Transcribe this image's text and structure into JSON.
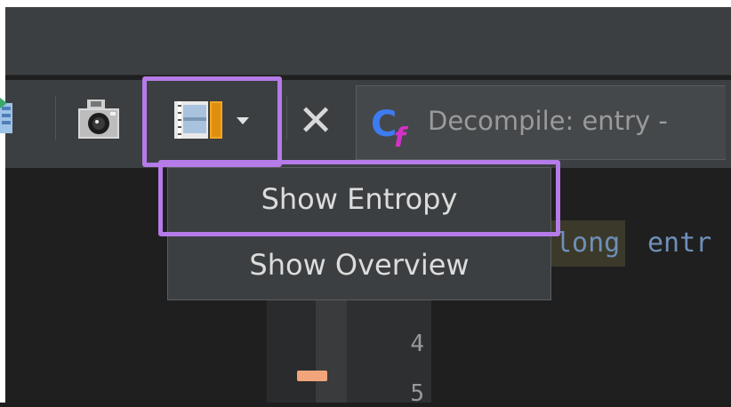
{
  "toolbar": {
    "icons": [
      "file-icon",
      "camera-icon",
      "film-strip-icon",
      "dropdown-arrow-icon",
      "close-icon"
    ],
    "close_label": "✕"
  },
  "decompile_tab": {
    "label": "Decompile: entry -",
    "icon": "cf-icon"
  },
  "menu": {
    "items": [
      {
        "label": "Show Entropy",
        "highlighted": true
      },
      {
        "label": "Show Overview",
        "highlighted": false
      }
    ]
  },
  "editor": {
    "code_keyword": "long",
    "code_rest": " entr"
  },
  "gutter": {
    "line_numbers": [
      "4",
      "5"
    ]
  },
  "colors": {
    "highlight": "#b57be8",
    "toolbar_bg": "#3c3f41",
    "editor_bg": "#1f1f1f",
    "marker": "#f2a57a"
  }
}
